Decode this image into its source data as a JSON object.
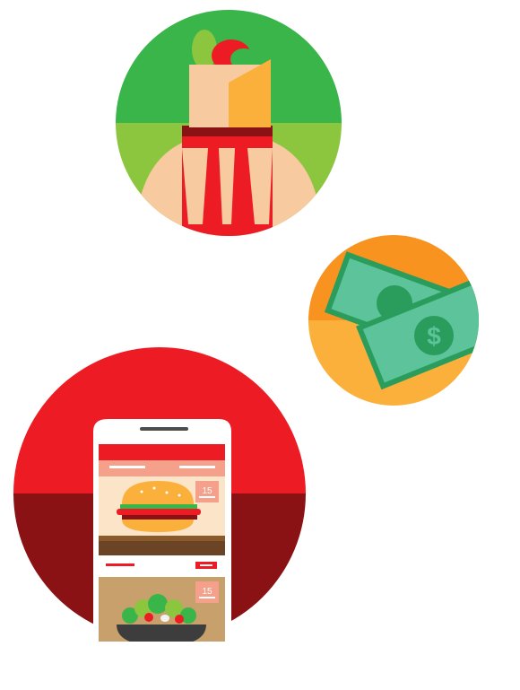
{
  "illustrations": {
    "wrap_icon": {
      "name": "burrito-wrap-icon"
    },
    "money_icon": {
      "name": "dollar-bills-icon",
      "currency_symbol": "$"
    },
    "phone_icon": {
      "name": "food-ordering-app-icon"
    }
  },
  "phone_screen": {
    "items": [
      {
        "badge": "15",
        "name": "burger"
      },
      {
        "badge": "15",
        "name": "salad"
      }
    ]
  },
  "colors": {
    "green_light": "#8cc63f",
    "green_dark": "#39b54a",
    "skin": "#f7caa0",
    "red": "#ed1c24",
    "dark_red": "#8b1214",
    "orange": "#f7931e",
    "yellow_orange": "#fbb03b",
    "bill_green": "#5dc39a",
    "bill_dark": "#2a9d5c"
  }
}
